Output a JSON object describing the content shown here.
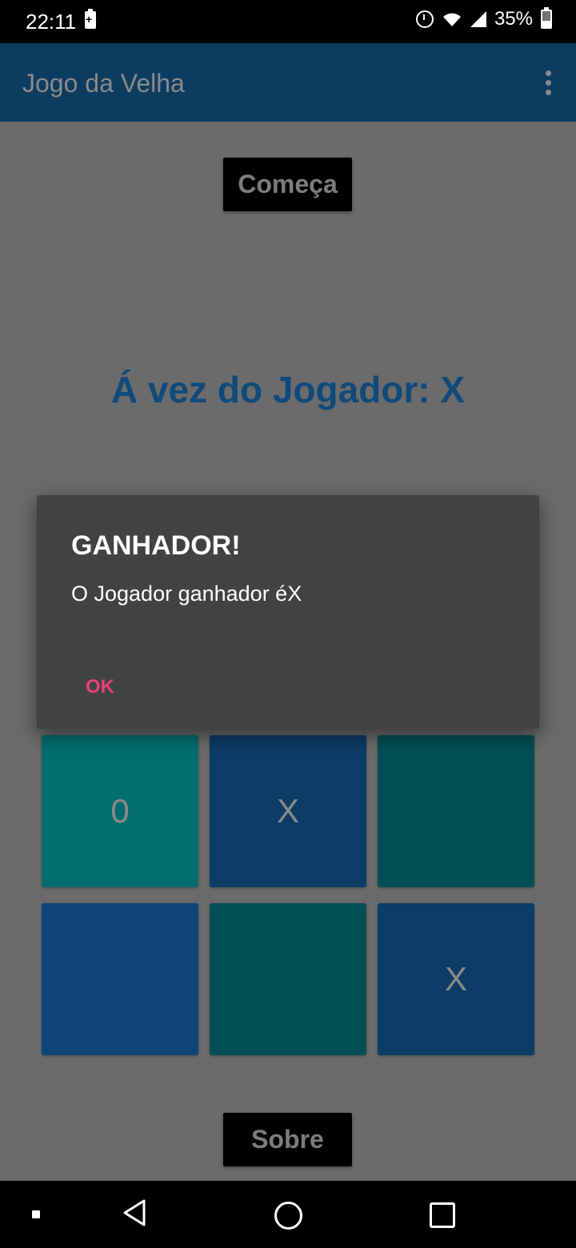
{
  "status_bar": {
    "time": "22:11",
    "battery_percent": "35%",
    "icons": [
      "battery-saver-icon",
      "alarm-icon",
      "wifi-icon",
      "signal-icon",
      "battery-icon"
    ]
  },
  "app_bar": {
    "title": "Jogo da Velha",
    "menu_icon": "overflow-menu-icon"
  },
  "buttons": {
    "start": "Começa",
    "about": "Sobre"
  },
  "turn_label": "Á vez do Jogador: X",
  "board": {
    "row2": [
      "0",
      "X",
      ""
    ],
    "row3": [
      "",
      "",
      "X"
    ]
  },
  "dialog": {
    "title": "GANHADOR!",
    "message": "O Jogador ganhador éX",
    "ok_label": "OK"
  },
  "colors": {
    "app_bar": "#0d3c61",
    "accent": "#e8407c",
    "dialog_bg": "#424242",
    "turn_text": "#104a7a"
  },
  "nav_bar": {
    "icons": [
      "nav-square-icon",
      "back-icon",
      "home-icon",
      "recents-icon"
    ]
  }
}
